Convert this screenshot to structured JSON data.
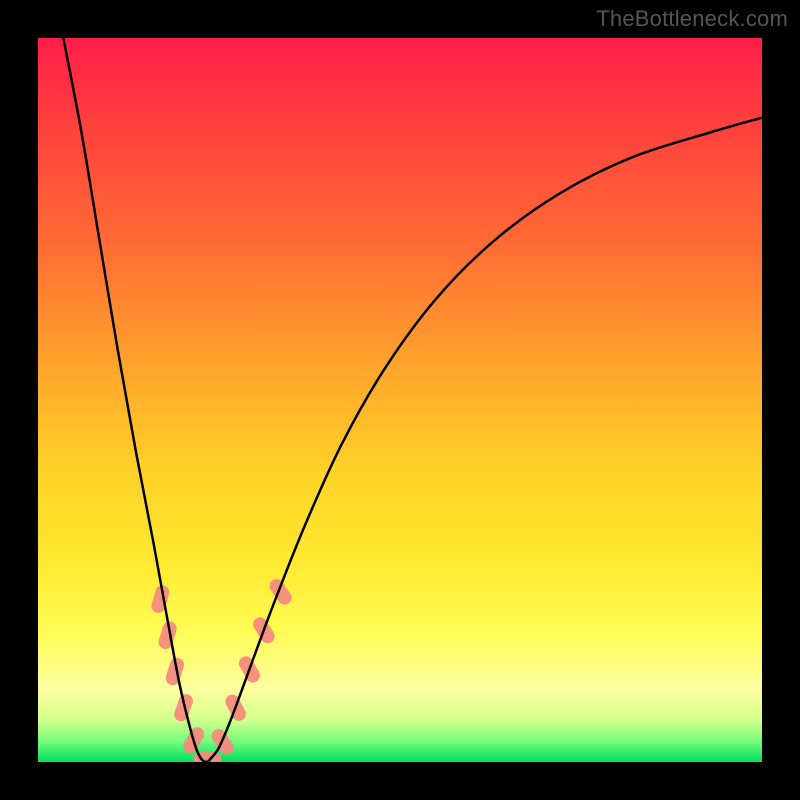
{
  "watermark": "TheBottleneck.com",
  "chart_data": {
    "type": "line",
    "title": "",
    "xlabel": "",
    "ylabel": "",
    "xlim": [
      0,
      1
    ],
    "ylim": [
      0,
      1
    ],
    "grid": false,
    "series": [
      {
        "name": "curve",
        "color": "#000000",
        "stroke_width": 2.5,
        "x": [
          0.035,
          0.06,
          0.085,
          0.11,
          0.135,
          0.16,
          0.18,
          0.195,
          0.208,
          0.218,
          0.225,
          0.232,
          0.238,
          0.25,
          0.265,
          0.28,
          0.3,
          0.33,
          0.37,
          0.42,
          0.48,
          0.55,
          0.63,
          0.72,
          0.82,
          0.93,
          1.0
        ],
        "y": [
          1.0,
          0.87,
          0.72,
          0.57,
          0.43,
          0.3,
          0.19,
          0.11,
          0.055,
          0.02,
          0.005,
          0.0,
          0.004,
          0.02,
          0.055,
          0.095,
          0.15,
          0.23,
          0.33,
          0.44,
          0.545,
          0.64,
          0.72,
          0.785,
          0.835,
          0.87,
          0.89
        ]
      }
    ],
    "markers": {
      "name": "dash-markers",
      "shape": "rounded-segment",
      "color": "#f58b7d",
      "points": [
        {
          "x": 0.169,
          "y": 0.225,
          "angle": -74
        },
        {
          "x": 0.179,
          "y": 0.175,
          "angle": -73
        },
        {
          "x": 0.189,
          "y": 0.125,
          "angle": -72
        },
        {
          "x": 0.201,
          "y": 0.075,
          "angle": -70
        },
        {
          "x": 0.215,
          "y": 0.03,
          "angle": -60
        },
        {
          "x": 0.234,
          "y": 0.004,
          "angle": 0
        },
        {
          "x": 0.255,
          "y": 0.028,
          "angle": 55
        },
        {
          "x": 0.273,
          "y": 0.075,
          "angle": 62
        },
        {
          "x": 0.292,
          "y": 0.128,
          "angle": 60
        },
        {
          "x": 0.312,
          "y": 0.182,
          "angle": 58
        },
        {
          "x": 0.335,
          "y": 0.235,
          "angle": 55
        }
      ]
    },
    "background_gradient": {
      "type": "vertical",
      "stops": [
        {
          "pos": 0.0,
          "color": "#ff1e4a"
        },
        {
          "pos": 0.28,
          "color": "#ff6a34"
        },
        {
          "pos": 0.6,
          "color": "#ffd227"
        },
        {
          "pos": 0.82,
          "color": "#fffb55"
        },
        {
          "pos": 0.94,
          "color": "#d6ff8c"
        },
        {
          "pos": 1.0,
          "color": "#00e060"
        }
      ]
    }
  }
}
